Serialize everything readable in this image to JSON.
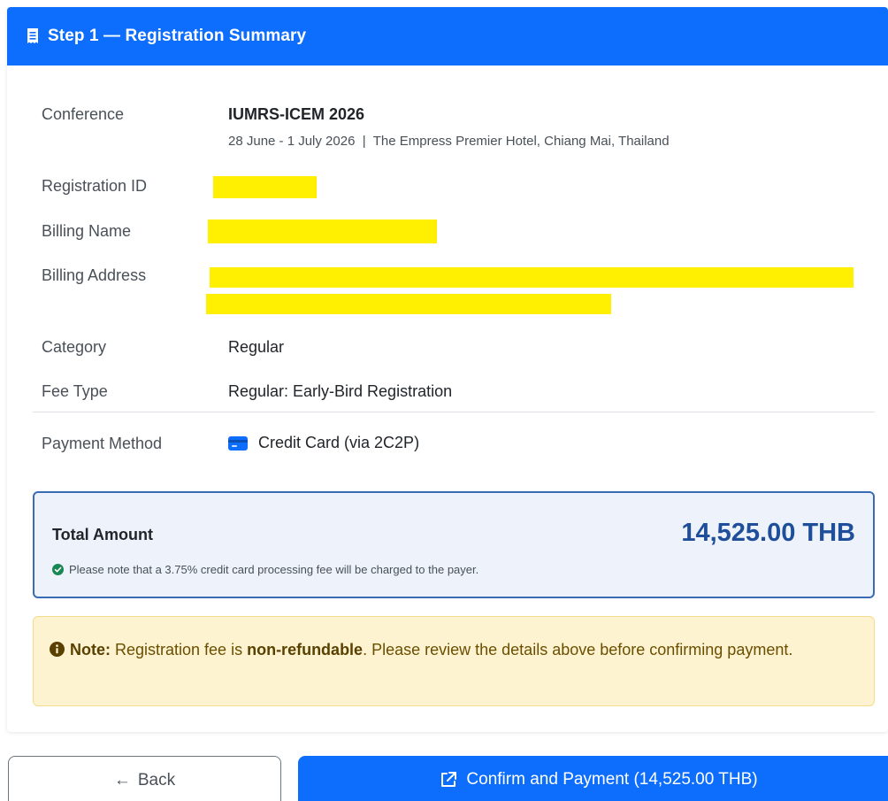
{
  "header": {
    "icon": "receipt-icon",
    "title": "Step 1 — Registration Summary",
    "color": "#0d6efd"
  },
  "summary": {
    "conference_label": "Conference",
    "conference_name": "IUMRS-ICEM 2026",
    "conference_details": "28 June - 1 July 2026  |  The Empress Premier Hotel, Chiang Mai, Thailand",
    "registration_id_label": "Registration ID",
    "billing_name_label": "Billing Name",
    "billing_address_label": "Billing Address",
    "category_label": "Category",
    "category_value": "Regular",
    "fee_type_label": "Fee Type",
    "fee_type_value": "Regular: Early-Bird Registration",
    "payment_method_label": "Payment Method",
    "payment_method_icon": "credit-card-icon",
    "payment_method_value": "Credit Card (via 2C2P)",
    "redaction_color": "#ffef00"
  },
  "total": {
    "label": "Total Amount",
    "amount": "14,525.00 THB",
    "note_icon": "check-circle-icon",
    "note": "Please note that a 3.75% credit card processing fee will be charged to the payer."
  },
  "note": {
    "icon": "info-circle-icon",
    "prefix": "Note:",
    "text1": " Registration fee is ",
    "bold": "non-refundable",
    "text2": ". Please review the details above before confirming payment."
  },
  "buttons": {
    "back_icon": "arrow-left-icon",
    "back_label": "Back",
    "confirm_icon": "external-link-icon",
    "confirm_label": "Confirm and Payment (14,525.00 THB)"
  }
}
